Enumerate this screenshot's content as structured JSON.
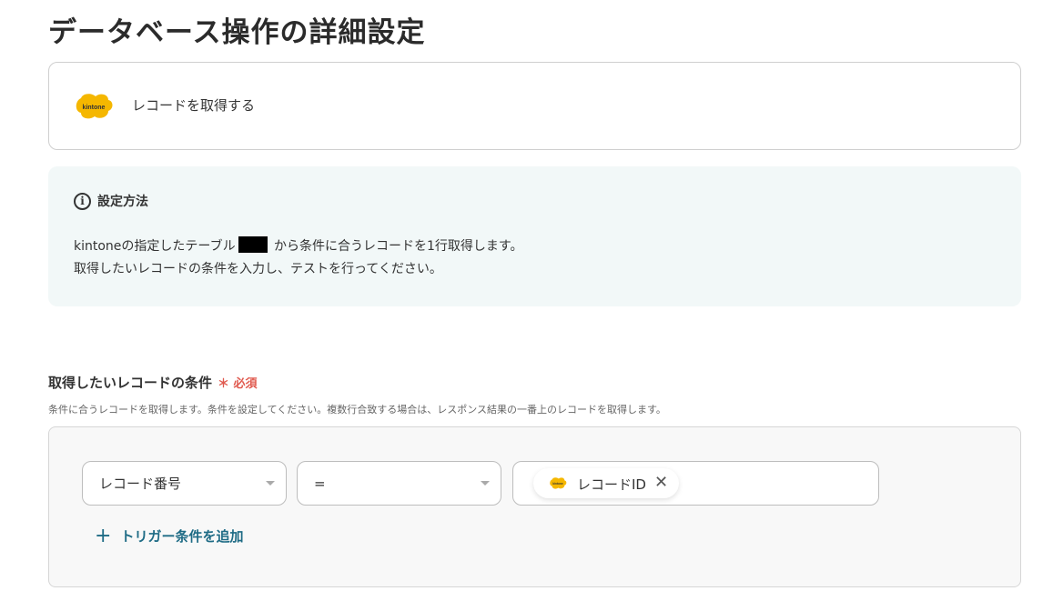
{
  "page": {
    "title": "データベース操作の詳細設定"
  },
  "app_card": {
    "logo_text": "kintone",
    "action": "レコードを取得する"
  },
  "info": {
    "title": "設定方法",
    "line1_before": "kintoneの指定したテーブル",
    "line1_after": " から条件に合うレコードを1行取得します。",
    "line2": "取得したいレコードの条件を入力し、テストを行ってください。"
  },
  "condition": {
    "label": "取得したいレコードの条件",
    "required": "必須",
    "description": "条件に合うレコードを取得します。条件を設定してください。複数行合致する場合は、レスポンス結果の一番上のレコードを取得します。",
    "field_select": "レコード番号",
    "operator_select": "=",
    "value_chip": {
      "logo_text": "kintone",
      "label": "レコードID",
      "close": "✕"
    },
    "add_button": "トリガー条件を追加",
    "add_icon": "+"
  },
  "colors": {
    "accent": "#1e6b85",
    "required": "#e05a4f",
    "info_bg": "#f2f8f8",
    "logo": "#f5b700"
  }
}
